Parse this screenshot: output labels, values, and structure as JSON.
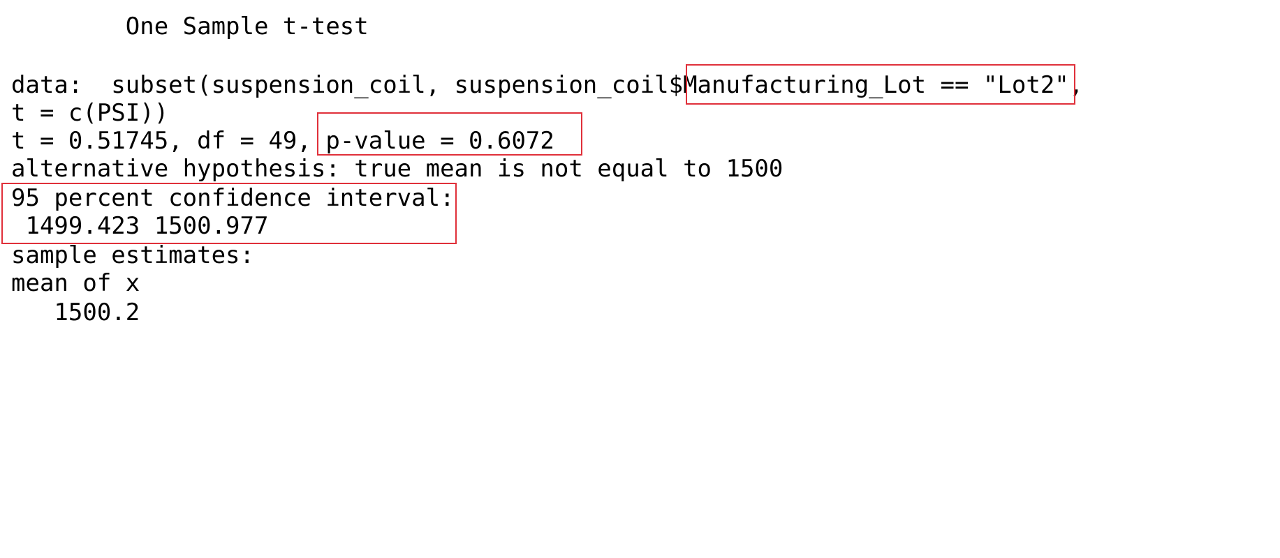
{
  "console": {
    "title": "        One Sample t-test",
    "data_line": {
      "prefix": "data:  subset(suspension_coil, suspension_coil$",
      "highlight": "Manufacturing_Lot == \"Lot2\"",
      "suffix": ","
    },
    "data_line2": "t = c(PSI))",
    "stat_line": {
      "prefix": "t = 0.51745, df = 49, ",
      "highlight": "p-value = 0.6072"
    },
    "alt_line": "alternative hypothesis: true mean is not equal to 1500",
    "ci_header": "95 percent confidence interval:",
    "ci_values": " 1499.423 1500.977",
    "estimates_header": "sample estimates:",
    "mean_label": "mean of x",
    "mean_value": "   1500.2"
  },
  "colors": {
    "highlight_border": "#e0303a",
    "text": "#000000",
    "background": "#ffffff"
  }
}
